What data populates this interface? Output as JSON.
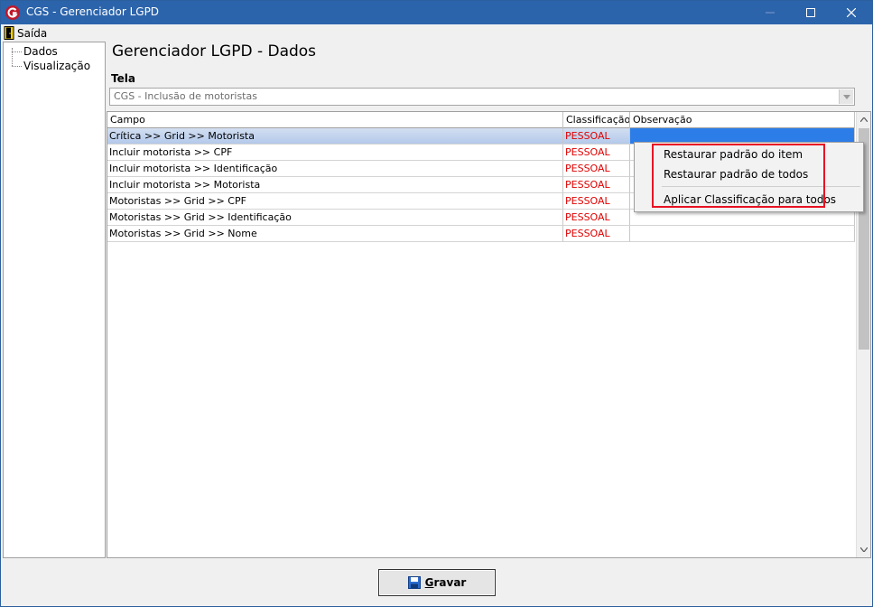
{
  "window": {
    "title": "CGS - Gerenciador LGPD"
  },
  "menu": {
    "exit_label": "Saída"
  },
  "tree": {
    "items": [
      {
        "label": "Dados"
      },
      {
        "label": "Visualização"
      }
    ]
  },
  "main": {
    "page_title": "Gerenciador LGPD - Dados",
    "tela_label": "Tela",
    "tela_value": "CGS - Inclusão de motoristas"
  },
  "grid": {
    "columns": {
      "campo": "Campo",
      "classificacao": "Classificação",
      "observacao": "Observação"
    },
    "rows": [
      {
        "campo": "Crítica >> Grid >> Motorista",
        "classificacao": "PESSOAL",
        "observacao": ""
      },
      {
        "campo": "Incluir motorista >> CPF",
        "classificacao": "PESSOAL",
        "observacao": ""
      },
      {
        "campo": "Incluir motorista >> Identificação",
        "classificacao": "PESSOAL",
        "observacao": ""
      },
      {
        "campo": "Incluir motorista >> Motorista",
        "classificacao": "PESSOAL",
        "observacao": ""
      },
      {
        "campo": "Motoristas >> Grid >> CPF",
        "classificacao": "PESSOAL",
        "observacao": ""
      },
      {
        "campo": "Motoristas >> Grid >> Identificação",
        "classificacao": "PESSOAL",
        "observacao": ""
      },
      {
        "campo": "Motoristas >> Grid >> Nome",
        "classificacao": "PESSOAL",
        "observacao": ""
      }
    ]
  },
  "context_menu": {
    "items": [
      {
        "label": "Restaurar padrão do item"
      },
      {
        "label": "Restaurar padrão de todos"
      },
      {
        "label": "Aplicar Classificação para todos"
      }
    ]
  },
  "footer": {
    "save_label_accel": "G",
    "save_label_rest": "ravar"
  },
  "colors": {
    "titlebar": "#2c64ab",
    "classification_text": "#e00000",
    "selection": "#2c7de8",
    "highlight_box": "#e81123"
  }
}
